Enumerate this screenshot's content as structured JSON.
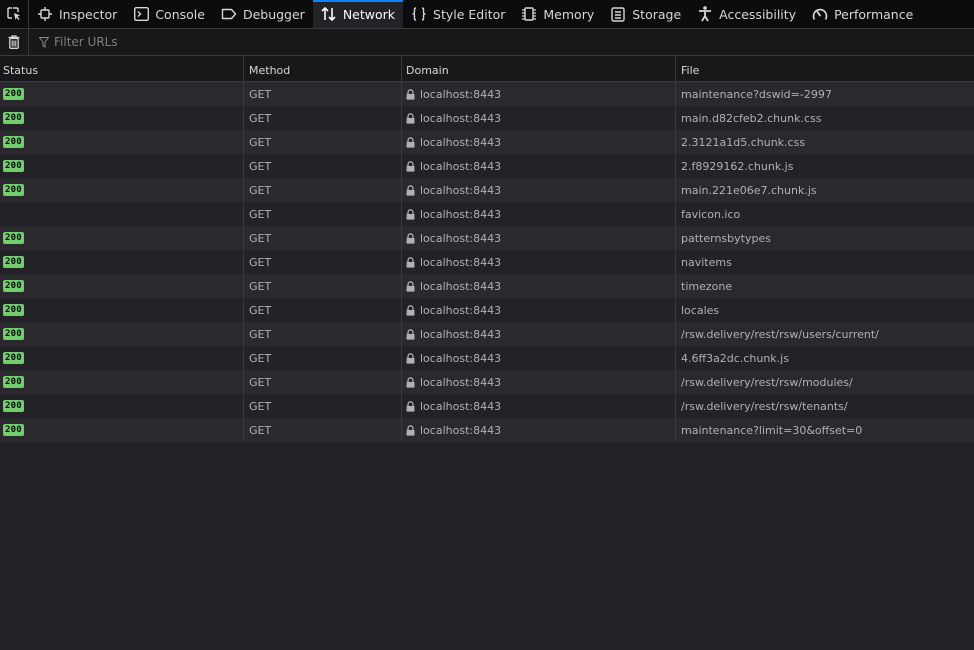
{
  "toolbox": {
    "tabs": [
      {
        "label": "Inspector",
        "icon": "inspector-icon"
      },
      {
        "label": "Console",
        "icon": "console-icon"
      },
      {
        "label": "Debugger",
        "icon": "debugger-icon"
      },
      {
        "label": "Network",
        "icon": "network-icon",
        "selected": true
      },
      {
        "label": "Style Editor",
        "icon": "style-editor-icon"
      },
      {
        "label": "Memory",
        "icon": "memory-icon"
      },
      {
        "label": "Storage",
        "icon": "storage-icon"
      },
      {
        "label": "Accessibility",
        "icon": "accessibility-icon"
      },
      {
        "label": "Performance",
        "icon": "performance-icon"
      }
    ]
  },
  "filter": {
    "placeholder": "Filter URLs",
    "value": ""
  },
  "table": {
    "columns": {
      "status": "Status",
      "method": "Method",
      "domain": "Domain",
      "file": "File"
    },
    "rows": [
      {
        "status": "200",
        "method": "GET",
        "domain": "localhost:8443",
        "file": "maintenance?dswid=-2997"
      },
      {
        "status": "200",
        "method": "GET",
        "domain": "localhost:8443",
        "file": "main.d82cfeb2.chunk.css"
      },
      {
        "status": "200",
        "method": "GET",
        "domain": "localhost:8443",
        "file": "2.3121a1d5.chunk.css"
      },
      {
        "status": "200",
        "method": "GET",
        "domain": "localhost:8443",
        "file": "2.f8929162.chunk.js"
      },
      {
        "status": "200",
        "method": "GET",
        "domain": "localhost:8443",
        "file": "main.221e06e7.chunk.js"
      },
      {
        "status": "",
        "method": "GET",
        "domain": "localhost:8443",
        "file": "favicon.ico"
      },
      {
        "status": "200",
        "method": "GET",
        "domain": "localhost:8443",
        "file": "patternsbytypes"
      },
      {
        "status": "200",
        "method": "GET",
        "domain": "localhost:8443",
        "file": "navitems"
      },
      {
        "status": "200",
        "method": "GET",
        "domain": "localhost:8443",
        "file": "timezone"
      },
      {
        "status": "200",
        "method": "GET",
        "domain": "localhost:8443",
        "file": "locales"
      },
      {
        "status": "200",
        "method": "GET",
        "domain": "localhost:8443",
        "file": "/rsw.delivery/rest/rsw/users/current/"
      },
      {
        "status": "200",
        "method": "GET",
        "domain": "localhost:8443",
        "file": "4.6ff3a2dc.chunk.js"
      },
      {
        "status": "200",
        "method": "GET",
        "domain": "localhost:8443",
        "file": "/rsw.delivery/rest/rsw/modules/"
      },
      {
        "status": "200",
        "method": "GET",
        "domain": "localhost:8443",
        "file": "/rsw.delivery/rest/rsw/tenants/"
      },
      {
        "status": "200",
        "method": "GET",
        "domain": "localhost:8443",
        "file": "maintenance?limit=30&offset=0"
      }
    ]
  },
  "colors": {
    "accent": "#0a84ff",
    "status_ok": "#70ce6b"
  }
}
